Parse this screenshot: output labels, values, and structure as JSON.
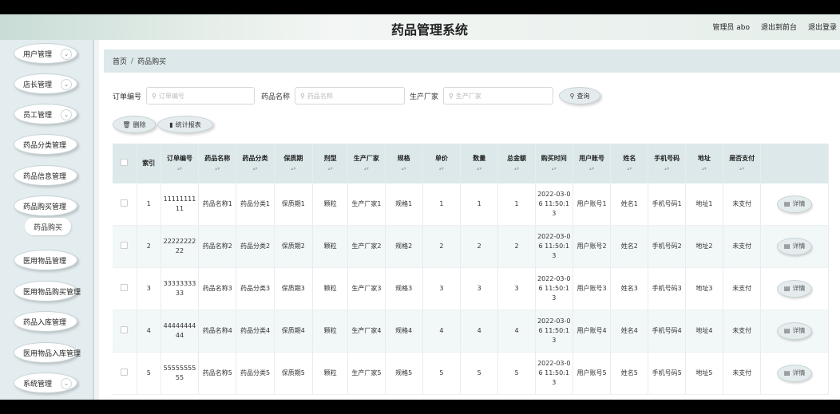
{
  "header": {
    "title": "药品管理系统",
    "admin": "管理员 abo",
    "front": "退出到前台",
    "logout": "退出登录"
  },
  "sidebar": {
    "items": [
      {
        "label": "用户管理",
        "chev": true
      },
      {
        "label": "店长管理",
        "chev": true
      },
      {
        "label": "员工管理",
        "chev": true
      },
      {
        "label": "药品分类管理",
        "chev": false
      },
      {
        "label": "药品信息管理",
        "chev": false
      },
      {
        "label": "药品购买管理",
        "chev": false
      },
      {
        "label": "医用物品管理",
        "chev": false
      },
      {
        "label": "医用物品购买管理",
        "chev": false
      },
      {
        "label": "药品入库管理",
        "chev": false
      },
      {
        "label": "医用物品入库管理",
        "chev": false
      },
      {
        "label": "系统管理",
        "chev": true
      }
    ],
    "sub_active": "药品购买"
  },
  "breadcrumb": {
    "home": "首页",
    "sep": "/",
    "current": "药品购买"
  },
  "search": {
    "order_label": "订单编号",
    "order_placeholder": "订单编号",
    "name_label": "药品名称",
    "name_placeholder": "药品名称",
    "maker_label": "生产厂家",
    "maker_placeholder": "生产厂家",
    "query": "查询"
  },
  "actions": {
    "delete": "删除",
    "report": "统计报表"
  },
  "table": {
    "columns": [
      "索引",
      "订单编号",
      "药品名称",
      "药品分类",
      "保质期",
      "剂型",
      "生产厂家",
      "规格",
      "单价",
      "数量",
      "总金额",
      "购买时间",
      "用户账号",
      "姓名",
      "手机号码",
      "地址",
      "是否支付"
    ],
    "detail_label": "详情",
    "rows": [
      {
        "idx": "1",
        "order": "1111111111",
        "name": "药品名称1",
        "cat": "药品分类1",
        "shelf": "保质期1",
        "form": "颗粒",
        "maker": "生产厂家1",
        "spec": "规格1",
        "price": "1",
        "qty": "1",
        "total": "1",
        "time": "2022-03-06 11:50:13",
        "account": "用户账号1",
        "person": "姓名1",
        "phone": "手机号码1",
        "addr": "地址1",
        "paid": "未支付"
      },
      {
        "idx": "2",
        "order": "2222222222",
        "name": "药品名称2",
        "cat": "药品分类2",
        "shelf": "保质期2",
        "form": "颗粒",
        "maker": "生产厂家2",
        "spec": "规格2",
        "price": "2",
        "qty": "2",
        "total": "2",
        "time": "2022-03-06 11:50:13",
        "account": "用户账号2",
        "person": "姓名2",
        "phone": "手机号码2",
        "addr": "地址2",
        "paid": "未支付"
      },
      {
        "idx": "3",
        "order": "3333333333",
        "name": "药品名称3",
        "cat": "药品分类3",
        "shelf": "保质期3",
        "form": "颗粒",
        "maker": "生产厂家3",
        "spec": "规格3",
        "price": "3",
        "qty": "3",
        "total": "3",
        "time": "2022-03-06 11:50:13",
        "account": "用户账号3",
        "person": "姓名3",
        "phone": "手机号码3",
        "addr": "地址3",
        "paid": "未支付"
      },
      {
        "idx": "4",
        "order": "4444444444",
        "name": "药品名称4",
        "cat": "药品分类4",
        "shelf": "保质期4",
        "form": "颗粒",
        "maker": "生产厂家4",
        "spec": "规格4",
        "price": "4",
        "qty": "4",
        "total": "4",
        "time": "2022-03-06 11:50:13",
        "account": "用户账号4",
        "person": "姓名4",
        "phone": "手机号码4",
        "addr": "地址4",
        "paid": "未支付"
      },
      {
        "idx": "5",
        "order": "5555555555",
        "name": "药品名称5",
        "cat": "药品分类5",
        "shelf": "保质期5",
        "form": "颗粒",
        "maker": "生产厂家5",
        "spec": "规格5",
        "price": "5",
        "qty": "5",
        "total": "5",
        "time": "2022-03-06 11:50:13",
        "account": "用户账号5",
        "person": "姓名5",
        "phone": "手机号码5",
        "addr": "地址5",
        "paid": "未支付"
      }
    ]
  },
  "icons": {
    "search": "search-icon",
    "delete": "trash-icon",
    "report": "bar-chart-icon",
    "detail": "document-icon",
    "chevron": "chevron-down-icon"
  }
}
